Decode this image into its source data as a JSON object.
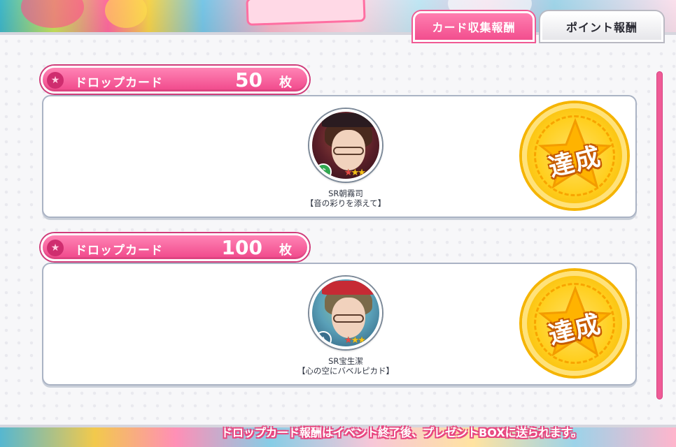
{
  "tabs": [
    {
      "label": "カード収集報酬",
      "active": true
    },
    {
      "label": "ポイント報酬",
      "active": false
    }
  ],
  "sections": [
    {
      "title": "ドロップカード",
      "count": "50",
      "unit": "枚",
      "card": {
        "name": "SR朝霧司",
        "subtitle": "【音の彩りを添えて】",
        "rarity_stars": 3,
        "attribute_icon": "music-note-icon"
      },
      "status": "達成"
    },
    {
      "title": "ドロップカード",
      "count": "100",
      "unit": "枚",
      "card": {
        "name": "SR宝生潔",
        "subtitle": "【心の空にバベルピカド】",
        "rarity_stars": 3,
        "attribute_icon": "graduation-cap-icon"
      },
      "status": "達成"
    }
  ],
  "footer": {
    "notice": "ドロップカード報酬はイベント終了後、プレゼントBOXに送られます。"
  },
  "colors": {
    "accent": "#f0478a",
    "stamp": "#ffcf1f"
  }
}
